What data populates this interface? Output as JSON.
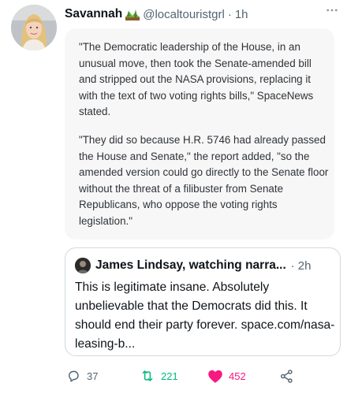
{
  "author": {
    "display_name": "Savannah",
    "emoji": "national-park-emoji",
    "handle": "@localtouristgrl",
    "separator": "·",
    "time": "1h"
  },
  "screenshot_text": {
    "paragraph_1": "\"The Democratic leadership of the House, in an unusual move, then took the Senate-amended bill and stripped out the NASA provisions, replacing it with the text of two voting rights bills,\" SpaceNews stated.",
    "paragraph_2": "\"They did so because H.R. 5746 had already passed the House and Senate,\" the report added, \"so the amended version could go directly to the Senate floor without the threat of a filibuster from Senate Republicans, who oppose the voting rights legislation.\""
  },
  "quoted_tweet": {
    "display_name": "James Lindsay, watching narra...",
    "separator": "·",
    "time": "2h",
    "text": "This is legitimate insane. Absolutely unbelievable that the Democrats did this. It should end their party forever. space.com/nasa-leasing-b..."
  },
  "actions": {
    "replies": "37",
    "retweets": "221",
    "likes": "452"
  },
  "colors": {
    "retweet_active": "#00ba7c",
    "like_active": "#f91880",
    "muted": "#536471"
  },
  "icons": [
    "more-icon",
    "reply-icon",
    "retweet-icon",
    "heart-filled-icon",
    "share-icon"
  ]
}
